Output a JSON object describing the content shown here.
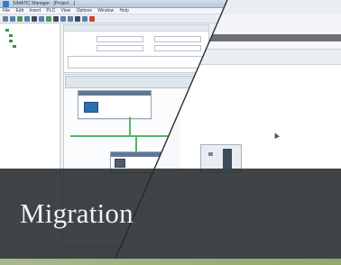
{
  "banner": {
    "title": "Migration"
  },
  "old_window": {
    "title": "SIMATIC Manager - [Project ...]",
    "menu": [
      "File",
      "Edit",
      "Insert",
      "PLC",
      "View",
      "Options",
      "Window",
      "Help"
    ]
  },
  "colors": {
    "banner_bg": "#262a2e",
    "banner_text": "#f2f2f2",
    "accent_bar": "#a0b07a",
    "connection_green": "#55b36b",
    "plc_blue": "#2c6fb0"
  },
  "icons": [
    "app-icon",
    "plc-module-icon",
    "mouse-cursor-icon"
  ]
}
